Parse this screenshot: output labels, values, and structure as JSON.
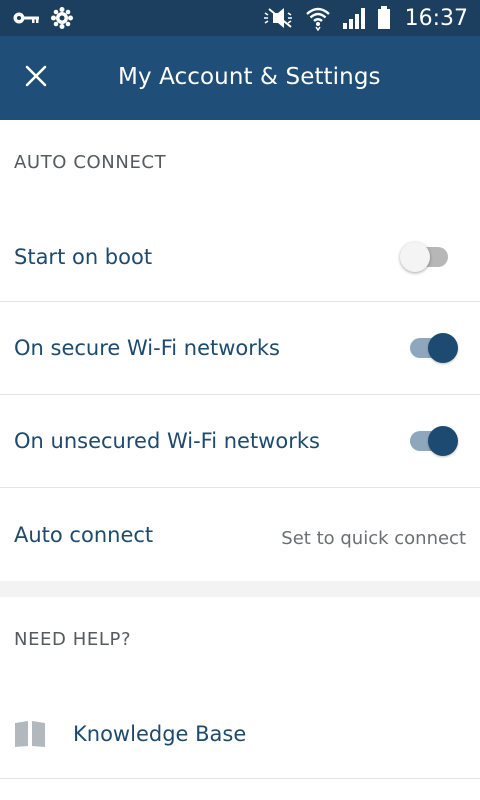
{
  "status_bar": {
    "time": "16:37",
    "icons": [
      "key-icon",
      "settings-notification-icon",
      "mute-icon",
      "wifi-icon",
      "signal-icon",
      "battery-icon"
    ]
  },
  "app_bar": {
    "title": "My Account & Settings",
    "close_icon": "close-icon"
  },
  "auto_connect": {
    "header": "AUTO CONNECT",
    "items": [
      {
        "label": "Start on boot",
        "toggle": "off"
      },
      {
        "label": "On secure Wi-Fi networks",
        "toggle": "on"
      },
      {
        "label": "On unsecured Wi-Fi networks",
        "toggle": "on"
      }
    ],
    "auto_connect_label": "Auto connect",
    "auto_connect_value": "Set to quick connect"
  },
  "help": {
    "header": "NEED HELP?",
    "knowledge_base_label": "Knowledge Base",
    "knowledge_base_icon": "book-icon"
  },
  "colors": {
    "status_bar": "#1c3e5f",
    "app_bar": "#1f4e79",
    "accent": "#1c4a71",
    "label_text": "#1e4a6e"
  }
}
